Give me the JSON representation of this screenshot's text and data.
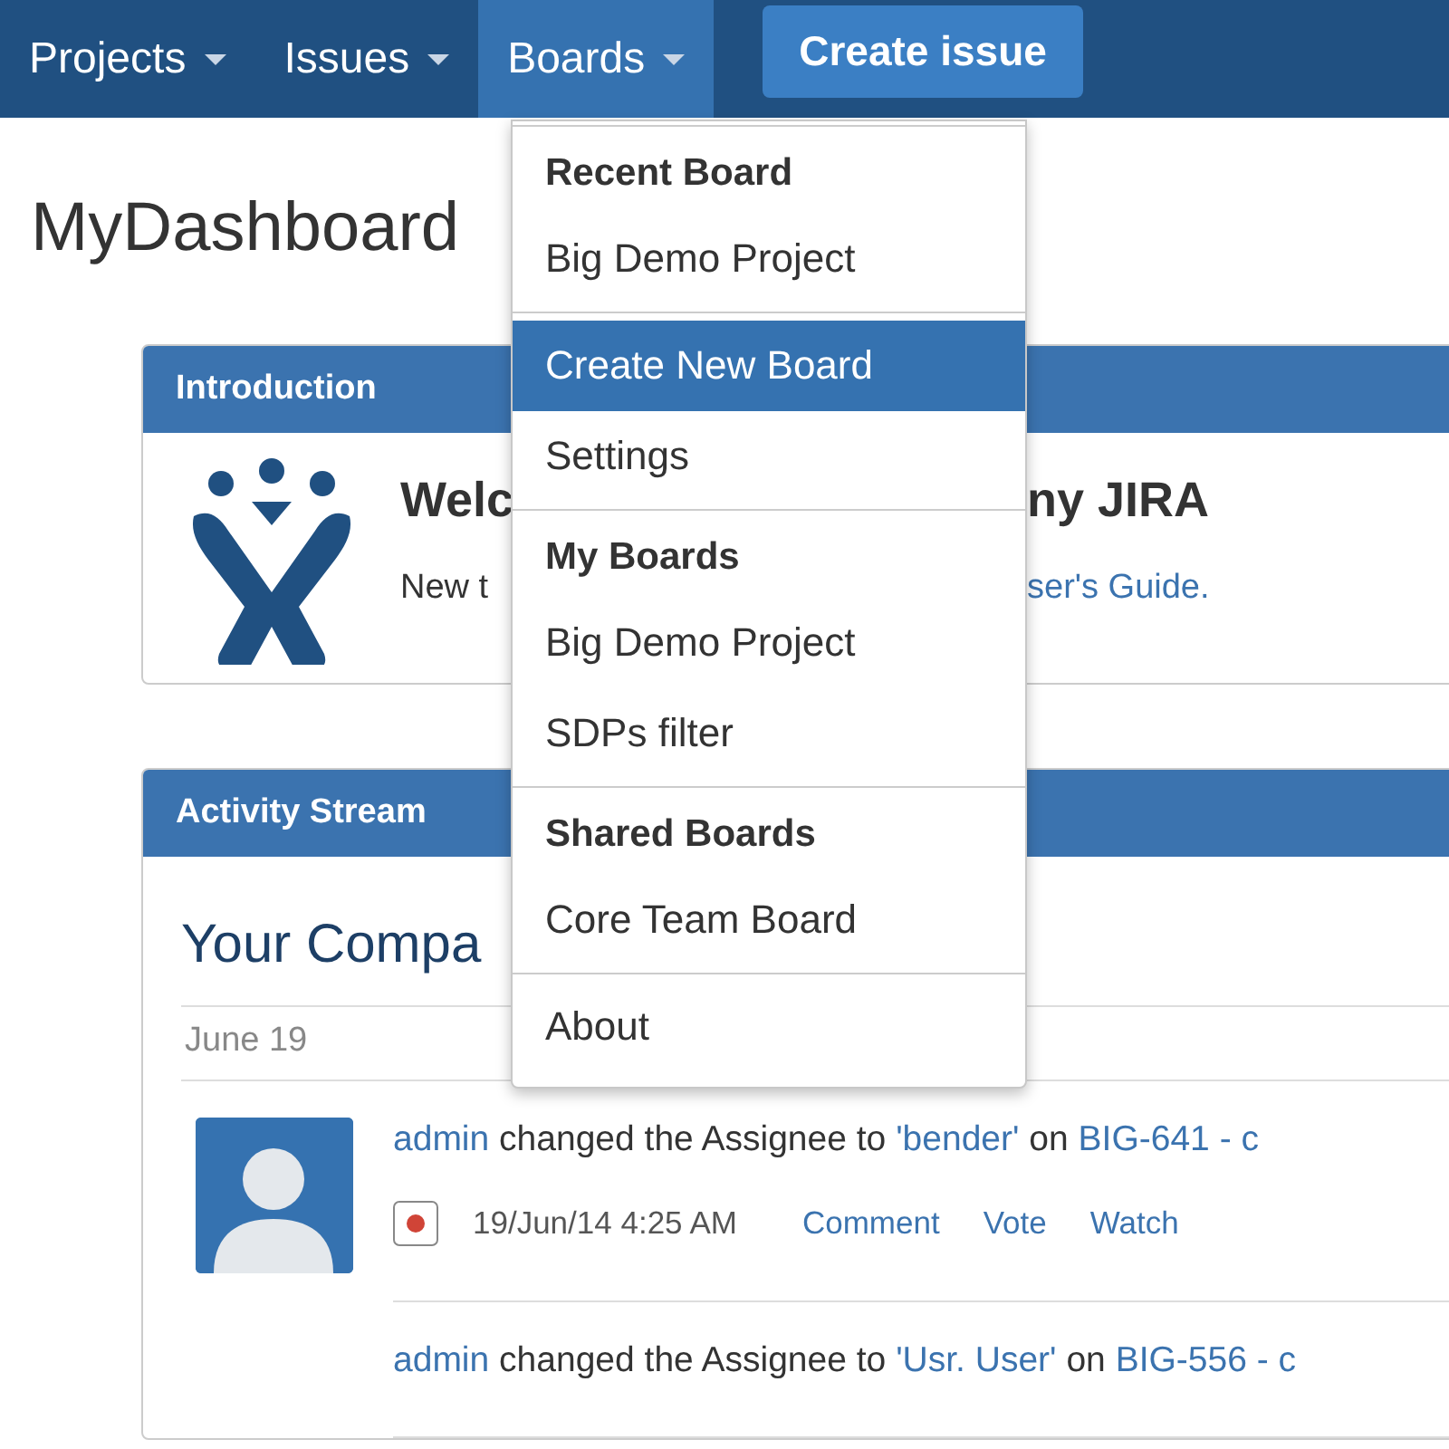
{
  "nav": {
    "items": [
      {
        "label": "Projects",
        "selected": false
      },
      {
        "label": "Issues",
        "selected": false
      },
      {
        "label": "Boards",
        "selected": true
      }
    ],
    "create_button": "Create issue"
  },
  "page_title": "MyDashboard",
  "boards_menu": {
    "sections": [
      {
        "heading": "Recent Board",
        "items": [
          {
            "label": "Big Demo Project",
            "selected": false
          }
        ]
      },
      {
        "items": [
          {
            "label": "Create New Board",
            "selected": true
          },
          {
            "label": "Settings",
            "selected": false
          }
        ]
      },
      {
        "heading": "My Boards",
        "items": [
          {
            "label": "Big Demo Project",
            "selected": false
          },
          {
            "label": "SDPs filter",
            "selected": false
          }
        ]
      },
      {
        "heading": "Shared Boards",
        "items": [
          {
            "label": "Core Team Board",
            "selected": false
          }
        ]
      },
      {
        "items": [
          {
            "label": "About",
            "selected": false
          }
        ]
      }
    ]
  },
  "introduction": {
    "title": "Introduction",
    "heading_parts": [
      "Welc",
      "ny JIRA"
    ],
    "text_parts": [
      {
        "text": "New t",
        "kind": "text"
      },
      {
        "text": "ser's Guide.",
        "kind": "link"
      }
    ]
  },
  "activity_stream": {
    "title": "Activity Stream",
    "heading": "Your Compa",
    "date": "June 19",
    "entries": [
      {
        "avatar": true,
        "segments": [
          {
            "text": "admin",
            "kind": "link"
          },
          {
            "text": "changed the Assignee to",
            "kind": "text"
          },
          {
            "text": "'bender'",
            "kind": "link"
          },
          {
            "text": "on",
            "kind": "text"
          },
          {
            "text": "BIG-641 - c",
            "kind": "link"
          }
        ],
        "time": "19/Jun/14 4:25 AM",
        "actions": [
          "Comment",
          "Vote",
          "Watch"
        ]
      },
      {
        "avatar": false,
        "segments": [
          {
            "text": "admin",
            "kind": "link"
          },
          {
            "text": "changed the Assignee to",
            "kind": "text"
          },
          {
            "text": "'Usr. User'",
            "kind": "link"
          },
          {
            "text": "on",
            "kind": "text"
          },
          {
            "text": "BIG-556 - c",
            "kind": "link"
          }
        ]
      }
    ]
  }
}
